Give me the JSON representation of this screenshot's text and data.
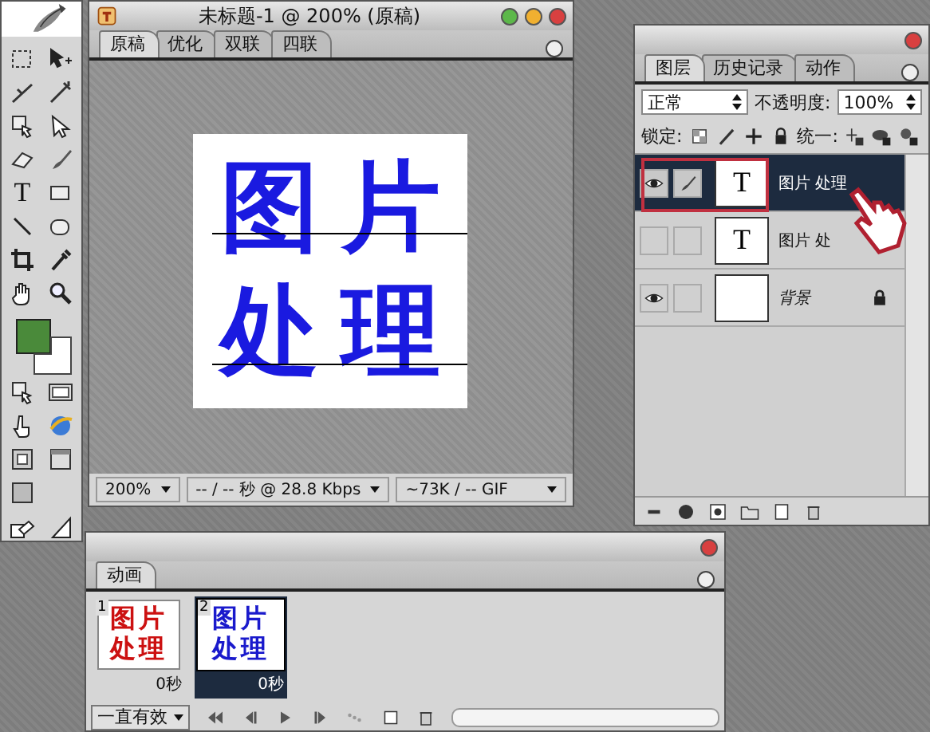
{
  "toolbox": {
    "text_tool_glyph": "T"
  },
  "document": {
    "title": "未标题-1 @ 200% (原稿)",
    "tabs": [
      {
        "label": "原稿",
        "selected": true
      },
      {
        "label": "优化",
        "selected": false
      },
      {
        "label": "双联",
        "selected": false
      },
      {
        "label": "四联",
        "selected": false
      }
    ],
    "canvas_lines": [
      "图片",
      "处理"
    ],
    "status": {
      "zoom": "200%",
      "download": "-- / -- 秒 @ 28.8 Kbps",
      "size": "~73K / -- GIF"
    }
  },
  "layers_panel": {
    "tabs": [
      {
        "label": "图层",
        "selected": true
      },
      {
        "label": "历史记录",
        "selected": false
      },
      {
        "label": "动作",
        "selected": false
      }
    ],
    "blend_mode": "正常",
    "opacity_label": "不透明度:",
    "opacity": "100%",
    "lock_label": "锁定:",
    "unify_label": "统一:",
    "layers": [
      {
        "kind": "text",
        "thumb": "T",
        "name": "图片 处理",
        "visible": true,
        "linked": true,
        "selected": true,
        "locked": false
      },
      {
        "kind": "text",
        "thumb": "T",
        "name": "图片 处",
        "visible": false,
        "linked": false,
        "selected": false,
        "locked": false
      },
      {
        "kind": "fill",
        "name": "背景",
        "visible": true,
        "linked": false,
        "selected": false,
        "locked": true
      }
    ]
  },
  "animation": {
    "tab": "动画",
    "frames": [
      {
        "number": "1",
        "lines": [
          "图片",
          "处理"
        ],
        "color": "#cc1111",
        "delay": "0秒",
        "selected": false
      },
      {
        "number": "2",
        "lines": [
          "图片",
          "处理"
        ],
        "color": "#1a1acc",
        "delay": "0秒",
        "selected": true
      }
    ],
    "loop": "一直有效"
  }
}
